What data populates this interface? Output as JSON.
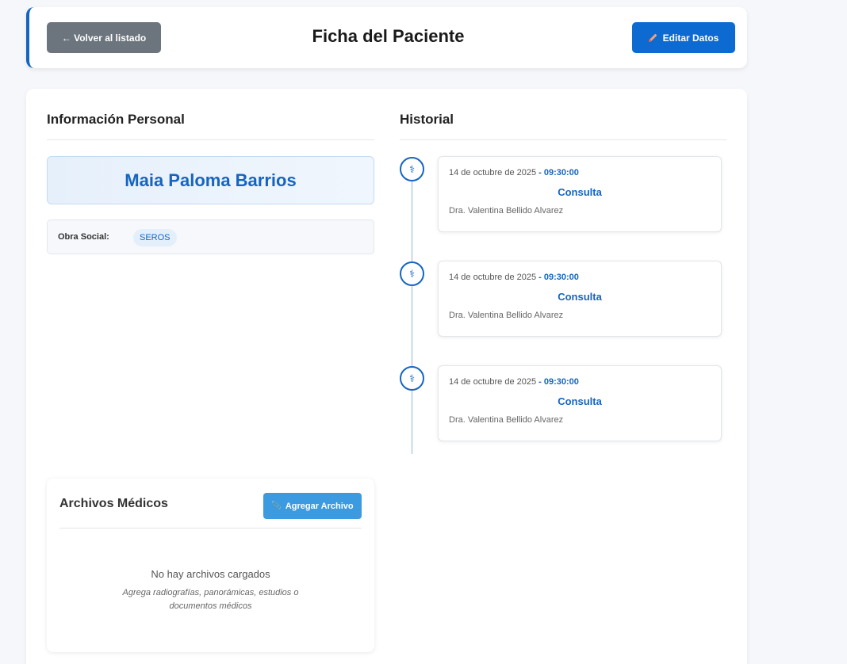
{
  "header": {
    "back_label": "← Volver al listado",
    "title": "Ficha del Paciente",
    "edit_label": "Editar Datos"
  },
  "personal": {
    "section_title": "Información Personal",
    "patient_name": "Maia Paloma Barrios",
    "obra_social_label": "Obra Social:",
    "obra_social_value": "SEROS"
  },
  "historial": {
    "section_title": "Historial",
    "items": [
      {
        "date": "14 de octubre de 2025",
        "time": "- 09:30:00",
        "type": "Consulta",
        "doctor": "Dra. Valentina Bellido Alvarez"
      },
      {
        "date": "14 de octubre de 2025",
        "time": "- 09:30:00",
        "type": "Consulta",
        "doctor": "Dra. Valentina Bellido Alvarez"
      },
      {
        "date": "14 de octubre de 2025",
        "time": "- 09:30:00",
        "type": "Consulta",
        "doctor": "Dra. Valentina Bellido Alvarez"
      }
    ]
  },
  "archivos": {
    "title": "Archivos Médicos",
    "add_label": "Agregar Archivo",
    "empty_text": "No hay archivos cargados",
    "hint_text": "Agrega radiografías, panorámicas, estudios o documentos médicos"
  },
  "colors": {
    "primary": "#1565c0",
    "secondary_button": "#6c757d",
    "add_button": "#3c9be0"
  }
}
